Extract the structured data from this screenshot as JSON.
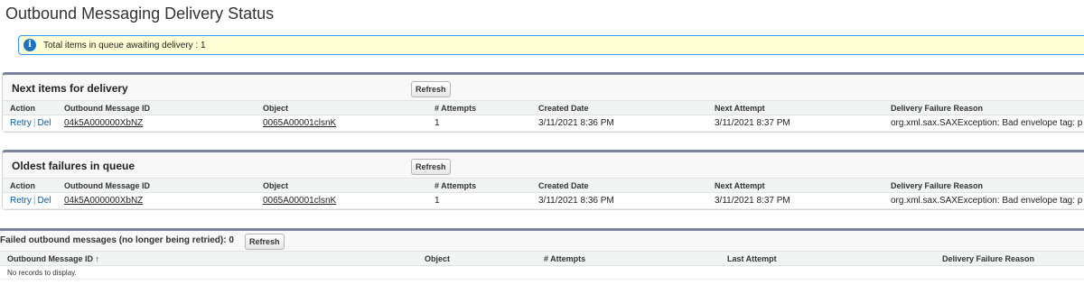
{
  "page": {
    "title": "Outbound Messaging Delivery Status"
  },
  "info": {
    "icon": "info-icon",
    "text": "Total items in queue awaiting delivery : 1"
  },
  "columns": {
    "action": "Action",
    "message_id": "Outbound Message ID",
    "object": "Object",
    "attempts": "# Attempts",
    "created": "Created Date",
    "next": "Next Attempt",
    "reason": "Delivery Failure Reason"
  },
  "next_items": {
    "title": "Next items for delivery",
    "refresh_label": "Refresh",
    "rows": [
      {
        "retry": "Retry",
        "del": "Del",
        "message_id": "04k5A000000XbNZ",
        "object": "0065A00001clsnK",
        "attempts": "1",
        "created": "3/11/2021 8:36 PM",
        "next": "3/11/2021 8:37 PM",
        "reason": "org.xml.sax.SAXException: Bad envelope tag: p"
      }
    ]
  },
  "oldest_failures": {
    "title": "Oldest failures in queue",
    "refresh_label": "Refresh",
    "rows": [
      {
        "retry": "Retry",
        "del": "Del",
        "message_id": "04k5A000000XbNZ",
        "object": "0065A00001clsnK",
        "attempts": "1",
        "created": "3/11/2021 8:36 PM",
        "next": "3/11/2021 8:37 PM",
        "reason": "org.xml.sax.SAXException: Bad envelope tag: p"
      }
    ]
  },
  "failed": {
    "title": "Failed outbound messages (no longer being retried): 0",
    "refresh_label": "Refresh",
    "columns": {
      "message_id": "Outbound Message ID",
      "sort_indicator": "↑",
      "object": "Object",
      "attempts": "# Attempts",
      "last": "Last Attempt",
      "reason": "Delivery Failure Reason"
    },
    "empty_text": "No records to display."
  },
  "colors": {
    "accent": "#015ba7",
    "info_bg": "#ffffd5",
    "info_border": "#3399ff",
    "block_top": "#7a8399"
  }
}
